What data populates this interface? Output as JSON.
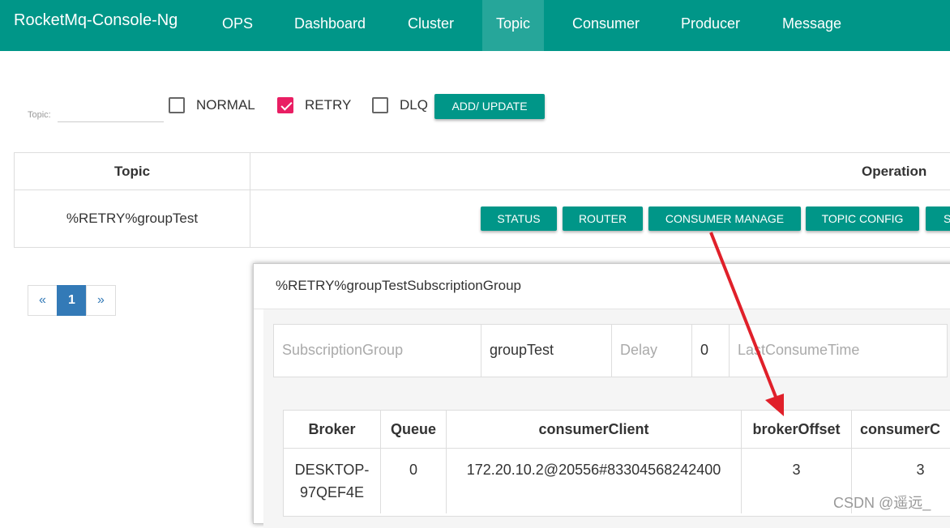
{
  "app": {
    "brand": "RocketMq-Console-Ng"
  },
  "nav": {
    "ops": "OPS",
    "dashboard": "Dashboard",
    "cluster": "Cluster",
    "topic": "Topic",
    "consumer": "Consumer",
    "producer": "Producer",
    "message": "Message"
  },
  "filter": {
    "topic_label": "Topic:",
    "topic_value": "",
    "normal_label": "NORMAL",
    "normal_checked": false,
    "retry_label": "RETRY",
    "retry_checked": true,
    "dlq_label": "DLQ",
    "dlq_checked": false,
    "add_update_label": "ADD/ UPDATE"
  },
  "topic_table": {
    "headers": {
      "topic": "Topic",
      "operation": "Operation"
    },
    "rows": [
      {
        "topic": "%RETRY%groupTest",
        "actions": [
          "STATUS",
          "ROUTER",
          "CONSUMER MANAGE",
          "TOPIC CONFIG",
          "S"
        ]
      }
    ]
  },
  "pagination": {
    "prev": "«",
    "current": "1",
    "next": "»"
  },
  "dialog": {
    "title": "%RETRY%groupTestSubscriptionGroup",
    "info": {
      "subscription_group_label": "SubscriptionGroup",
      "subscription_group_value": "groupTest",
      "delay_label": "Delay",
      "delay_value": "0",
      "last_consume_time_label": "LastConsumeTime"
    },
    "table": {
      "headers": [
        "Broker",
        "Queue",
        "consumerClient",
        "brokerOffset",
        "consumerC"
      ],
      "rows": [
        {
          "broker": "DESKTOP-97QEF4E",
          "queue": "0",
          "client": "172.20.10.2@20556#83304568242400",
          "broker_offset": "3",
          "consumer_offset": "3"
        }
      ]
    }
  },
  "watermark": "CSDN @遥远_",
  "colors": {
    "primary": "#009688",
    "active_nav": "#26a69a",
    "checkbox": "#e91e63",
    "pager_active": "#337ab7",
    "arrow": "#e0202a"
  }
}
